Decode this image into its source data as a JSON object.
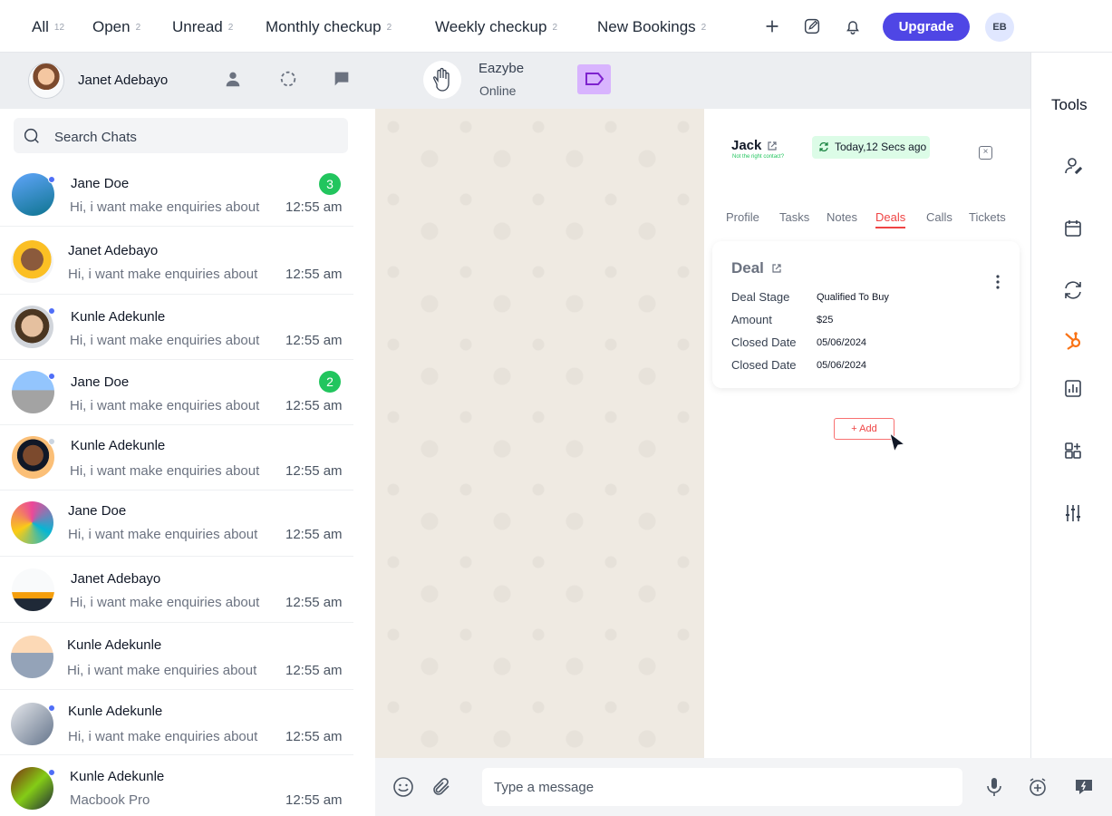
{
  "filters": [
    {
      "label": "All",
      "count": "12"
    },
    {
      "label": "Open",
      "count": "2"
    },
    {
      "label": "Unread",
      "count": "2"
    },
    {
      "label": "Monthly checkup",
      "count": "2"
    },
    {
      "label": "Weekly checkup",
      "count": "2"
    },
    {
      "label": "New Bookings",
      "count": "2"
    }
  ],
  "topbar": {
    "upgrade_label": "Upgrade",
    "user_initials": "EB"
  },
  "agent": {
    "name": "Janet Adebayo"
  },
  "bot": {
    "name": "Eazybe",
    "status": "Online"
  },
  "search": {
    "placeholder": "Search Chats"
  },
  "chats": [
    {
      "name": "Jane Doe",
      "message": "Hi, i want make enquiries about",
      "time": "12:55 am",
      "unread": "3"
    },
    {
      "name": "Janet Adebayo",
      "message": "Hi, i want make enquiries about",
      "time": "12:55 am",
      "unread": ""
    },
    {
      "name": "Kunle Adekunle",
      "message": "Hi, i want make enquiries about",
      "time": "12:55 am",
      "unread": ""
    },
    {
      "name": "Jane Doe",
      "message": "Hi, i want make enquiries about",
      "time": "12:55 am",
      "unread": "2"
    },
    {
      "name": "Kunle Adekunle",
      "message": "Hi, i want make enquiries about",
      "time": "12:55 am",
      "unread": ""
    },
    {
      "name": "Jane Doe",
      "message": "Hi, i want make enquiries about",
      "time": "12:55 am",
      "unread": ""
    },
    {
      "name": "Janet Adebayo",
      "message": "Hi, i want make enquiries about",
      "time": "12:55 am",
      "unread": ""
    },
    {
      "name": "Kunle Adekunle",
      "message": "Hi, i want make enquiries about",
      "time": "12:55 am",
      "unread": ""
    },
    {
      "name": "Kunle Adekunle",
      "message": "Hi, i want make enquiries about",
      "time": "12:55 am",
      "unread": ""
    },
    {
      "name": "Kunle Adekunle",
      "message": "Macbook Pro",
      "time": "12:55 am",
      "unread": ""
    }
  ],
  "contact": {
    "name": "Jack",
    "not_right_contact": "Not the right contact?",
    "sync_status": "Today,12 Secs ago",
    "tabs": [
      "Profile",
      "Tasks",
      "Notes",
      "Deals",
      "Calls",
      "Tickets"
    ],
    "active_tab": "Deals",
    "deal": {
      "title": "Deal",
      "fields": [
        {
          "label": "Deal Stage",
          "value": "Qualified To Buy"
        },
        {
          "label": "Amount",
          "value": "$25"
        },
        {
          "label": "Closed Date",
          "value": "05/06/2024"
        },
        {
          "label": "Closed Date",
          "value": "05/06/2024"
        }
      ]
    },
    "add_label": "Add"
  },
  "tools": {
    "title": "Tools"
  },
  "composer": {
    "placeholder": "Type a message"
  },
  "colors": {
    "accent": "#4f46e5",
    "unread_green": "#22c55e",
    "active_tab": "#ef4444",
    "hubspot": "#f97316"
  }
}
